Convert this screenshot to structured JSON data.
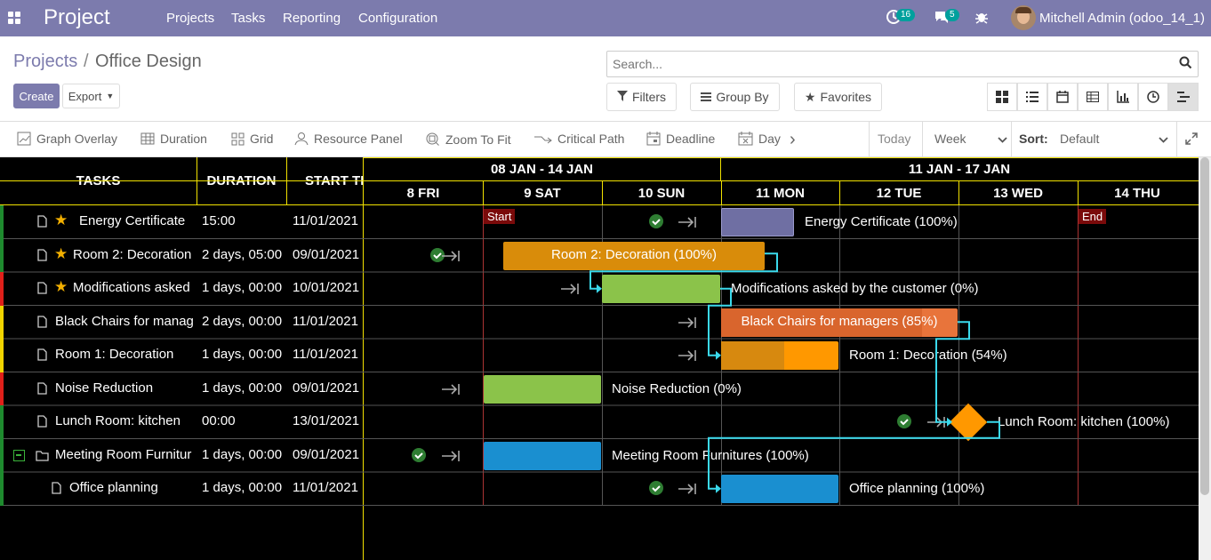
{
  "nav": {
    "brand": "Project",
    "menu": [
      "Projects",
      "Tasks",
      "Reporting",
      "Configuration"
    ],
    "activity_count": "16",
    "messages_count": "5",
    "user": "Mitchell Admin (odoo_14_1)"
  },
  "control_panel": {
    "breadcrumb_parent": "Projects",
    "breadcrumb_separator": "/",
    "breadcrumb_current": "Office Design",
    "create_label": "Create",
    "export_label": "Export",
    "search_placeholder": "Search...",
    "filters_label": "Filters",
    "groupby_label": "Group By",
    "favorites_label": "Favorites"
  },
  "toolbar": {
    "graph_overlay": "Graph Overlay",
    "duration": "Duration",
    "grid": "Grid",
    "resource_panel": "Resource Panel",
    "zoom_to_fit": "Zoom To Fit",
    "critical_path": "Critical Path",
    "deadline": "Deadline",
    "day": "Day",
    "today": "Today",
    "scale": "Week",
    "sort_label": "Sort:",
    "sort_value": "Default"
  },
  "gantt": {
    "columns": {
      "tasks": "TASKS",
      "duration": "DURATION",
      "start": "START TI"
    },
    "weeks": [
      "08 JAN - 14 JAN",
      "11 JAN - 17 JAN"
    ],
    "days": [
      "8 FRI",
      "9 SAT",
      "10 SUN",
      "11 MON",
      "12 TUE",
      "13 WED",
      "14 THU"
    ],
    "markers": {
      "start": "Start",
      "end": "End"
    },
    "tasks": [
      {
        "name": "Energy Certificate",
        "duration": "15:00",
        "start": "11/01/2021",
        "star": true,
        "status": "#1e8a2e",
        "bar_label": "Energy Certificate (100%)",
        "progress": 100,
        "color": "#6f6fa3"
      },
      {
        "name": "Room 2: Decoration",
        "duration": "2 days, 05:00",
        "start": "09/01/2021",
        "star": true,
        "status": "#1e8a2e",
        "bar_label": "Room 2: Decoration (100%)",
        "progress": 100,
        "color": "#d98c0a"
      },
      {
        "name": "Modifications asked",
        "duration": "1 days, 00:00",
        "start": "10/01/2021",
        "star": true,
        "status": "#e0201a",
        "bar_label": "Modifications asked by the customer (0%)",
        "progress": 0,
        "color": "#8bc34a"
      },
      {
        "name": "Black Chairs for manag",
        "duration": "2 days, 00:00",
        "start": "11/01/2021",
        "star": false,
        "status": "#f1d400",
        "bar_label": "Black Chairs for managers (85%)",
        "progress": 85,
        "color": "#e8743b"
      },
      {
        "name": "Room 1: Decoration",
        "duration": "1 days, 00:00",
        "start": "11/01/2021",
        "star": false,
        "status": "#f1d400",
        "bar_label": "Room 1: Decoration (54%)",
        "progress": 54,
        "color": "#ff9800"
      },
      {
        "name": "Noise Reduction",
        "duration": "1 days, 00:00",
        "start": "09/01/2021",
        "star": false,
        "status": "#e0201a",
        "bar_label": "Noise Reduction (0%)",
        "progress": 0,
        "color": "#8bc34a"
      },
      {
        "name": "Lunch Room: kitchen",
        "duration": "00:00",
        "start": "13/01/2021",
        "star": false,
        "status": "#1e8a2e",
        "bar_label": "Lunch Room: kitchen (100%)",
        "progress": 100,
        "color": "#ff9800"
      },
      {
        "name": "Meeting Room Furnitur",
        "duration": "1 days, 00:00",
        "start": "09/01/2021",
        "star": false,
        "status": "#1e8a2e",
        "bar_label": "Meeting Room Furnitures (100%)",
        "progress": 100,
        "color": "#1a8fd0"
      },
      {
        "name": "Office planning",
        "duration": "1 days, 00:00",
        "start": "11/01/2021",
        "star": false,
        "status": "#1e8a2e",
        "bar_label": "Office planning (100%)",
        "progress": 100,
        "color": "#1a8fd0"
      }
    ]
  }
}
